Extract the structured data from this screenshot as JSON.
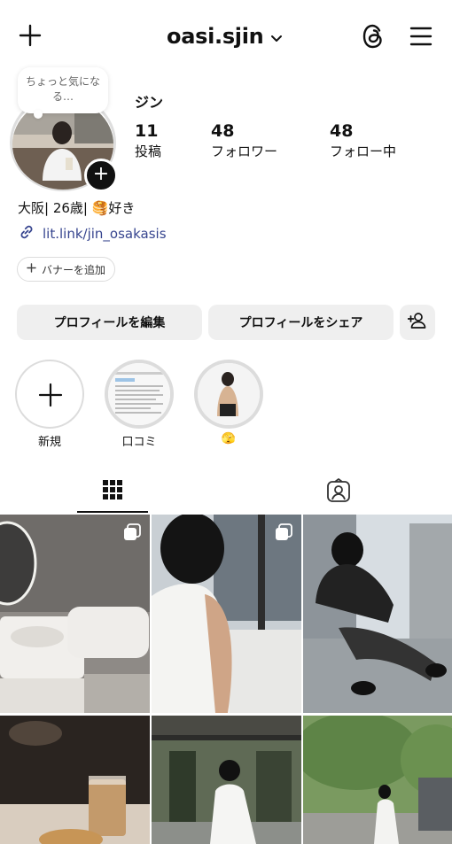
{
  "topbar": {
    "username": "oasi.sjin",
    "icons": [
      "plus-icon",
      "chevron-down-icon",
      "threads-icon",
      "menu-icon"
    ]
  },
  "profile": {
    "note": "ちょっと気になる…",
    "display_name": "ジン",
    "stats": [
      {
        "num": "11",
        "label": "投稿"
      },
      {
        "num": "48",
        "label": "フォロワー"
      },
      {
        "num": "48",
        "label": "フォロー中"
      }
    ],
    "bio": "大阪| 26歳| 🥞好き",
    "link": "lit.link/jin_osakasis",
    "banner_button": "バナーを追加"
  },
  "actions": {
    "edit": "プロフィールを編集",
    "share": "プロフィールをシェア"
  },
  "highlights": [
    {
      "label": "新規"
    },
    {
      "label": "口コミ"
    },
    {
      "label": "🫣"
    }
  ],
  "tabs": [
    "grid-icon",
    "tagged-icon"
  ],
  "posts": [
    {
      "desc": "bathroom",
      "multi": true
    },
    {
      "desc": "tank top by window",
      "multi": true
    },
    {
      "desc": "sitting on ledge",
      "multi": false
    },
    {
      "desc": "iced coffee",
      "multi": false
    },
    {
      "desc": "white shirt outdoor",
      "multi": false
    },
    {
      "desc": "tree street",
      "multi": false
    }
  ]
}
